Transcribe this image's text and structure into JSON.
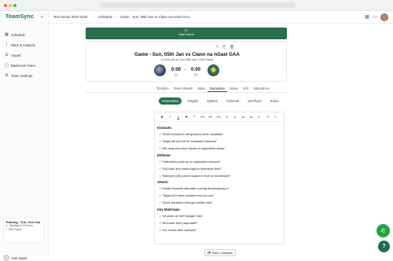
{
  "window": {
    "dot_colors": [
      "#ff5f57",
      "#febc2e",
      "#28c840"
    ]
  },
  "sidebar": {
    "brand": "TeamSync",
    "items": [
      {
        "icon": "calendar-icon",
        "glyph": "▦",
        "label": "Schedule"
      },
      {
        "icon": "chart-icon",
        "glyph": "⌇",
        "label": "Stats & Analysis"
      },
      {
        "icon": "squad-icon",
        "glyph": "☰",
        "label": "Squad"
      },
      {
        "icon": "backroom-icon",
        "glyph": "▢",
        "label": "Backroom Team"
      },
      {
        "icon": "gear-icon",
        "glyph": "⚙",
        "label": "Team Settings"
      }
    ],
    "training": {
      "title": "Training - Tue, 21st Jan",
      "starting": "Starting in 11 hours",
      "venue": "Eire Gaels"
    },
    "user_name": "Eire Gaels",
    "collapse_glyph": "«"
  },
  "breadcrumb": {
    "team": "Test Senior 2024-2025",
    "section": "Schedule",
    "page": "Game - Sun, 05th Jan vs Clann na nGael GAA",
    "sep": "›"
  },
  "start_game": {
    "icon": "▷",
    "label": "Start Game"
  },
  "game": {
    "tools": [
      "✎",
      "⎘",
      "🗑"
    ],
    "title": "Game - Sun, 05th Jan vs Clann na nGael GAA",
    "time": "6:15 pm on Sun 05th Jan",
    "venue": "Eire Gaels",
    "home_score": "0:00",
    "home_total": "(0)",
    "away_score": "0:00",
    "away_total": "(0)",
    "dash": "-"
  },
  "tabs": [
    "Timeline",
    "Team Sheets",
    "Stats",
    "Gameplan",
    "Notes",
    "Info",
    "Attendance"
  ],
  "active_tab": "Gameplan",
  "subtabs": [
    "Instructions",
    "Targets",
    "System",
    "Kickouts",
    "Set Plays",
    "Roles"
  ],
  "active_subtab": "Instructions",
  "toolbar": [
    "B",
    "I",
    "U",
    "S",
    "❝",
    "H1",
    "H2",
    "H3",
    "¶",
    "A",
    "≔",
    "≔",
    "⇤",
    "⇥",
    "≡"
  ],
  "instructions": [
    {
      "heading": "Kickouts:",
      "bullets": [
        "\"Short kickouts to wing-backs when available\"",
        "\"Target #6 and #9 for contested kickouts\"",
        "\"Mix long and short based on opposition setup\""
      ]
    },
    {
      "heading": "Defense:",
      "bullets": [
        "\"Half-backs push up on opposition kickouts\"",
        "\"Full-back line marks tight in defensive third\"",
        "\"Sweeper (#6) covers space in front of full-forward\""
      ]
    },
    {
      "heading": "Attack:",
      "bullets": [
        "\"Inside forwards alternate coming deep/staying in\"",
        "\"Target #14 when isolated one-on-one\"",
        "\"Quick transition through middle third\""
      ]
    },
    {
      "heading": "Key Matchups:",
      "bullets": [
        "\"#3 picks up their danger man\"",
        "\"#5 tracks their playmaker\"",
        "\"#11 marks their sweeper\""
      ]
    }
  ],
  "save_label": "Save Changes",
  "save_icon": "💾",
  "fabs": {
    "whatsapp_glyph": "✆",
    "whatsapp_color": "#25a244",
    "help_glyph": "?",
    "help_color": "#1f6f4a"
  },
  "colors": {
    "accent": "#2b6e4e",
    "brand": "#1f6f4a"
  }
}
